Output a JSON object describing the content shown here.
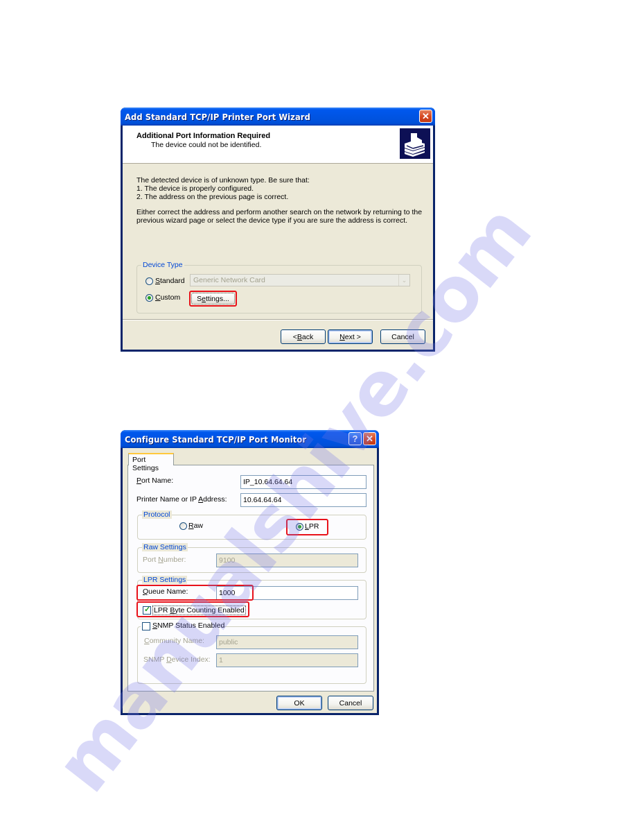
{
  "wizard": {
    "title": "Add Standard TCP/IP Printer Port Wizard",
    "header_title": "Additional Port Information Required",
    "header_subtitle": "The device could not be identified.",
    "header_icon": "printer-wizard-icon",
    "body_lines": [
      "The detected device is of unknown type.  Be sure that:",
      "1. The device is properly configured.",
      "2.  The address on the previous page is correct."
    ],
    "body_paragraph": [
      "Either correct the address and perform another search on the network by returning to the",
      "previous wizard page or select the device type if you are sure the address is correct."
    ],
    "device_type": {
      "group_label": "Device Type",
      "standard_label": "Standard",
      "standard_accel": "S",
      "standard_rest": "tandard",
      "standard_selected": false,
      "standard_dropdown_value": "Generic Network Card",
      "custom_label": "Custom",
      "custom_accel": "C",
      "custom_rest": "ustom",
      "custom_selected": true,
      "settings_button": "Settings...",
      "settings_pre": "S",
      "settings_accel": "e",
      "settings_rest": "ttings..."
    },
    "buttons": {
      "back": "< Back",
      "back_pre": "< ",
      "back_accel": "B",
      "back_rest": "ack",
      "next": "Next >",
      "next_accel": "N",
      "next_rest": "ext >",
      "cancel": "Cancel"
    }
  },
  "monitor": {
    "title": "Configure Standard TCP/IP Port Monitor",
    "tab": "Port Settings",
    "port_name": {
      "label": "Port Name:",
      "accel": "P",
      "rest": "ort Name:",
      "value": "IP_10.64.64.64"
    },
    "printer_address": {
      "label": "Printer Name or IP Address:",
      "pre": "Printer Name or IP ",
      "accel": "A",
      "rest": "ddress:",
      "value": "10.64.64.64"
    },
    "protocol": {
      "group_label": "Protocol",
      "raw_label": "Raw",
      "raw_accel": "R",
      "raw_rest": "aw",
      "raw_selected": false,
      "lpr_label": "LPR",
      "lpr_accel": "L",
      "lpr_rest": "PR",
      "lpr_selected": true
    },
    "raw_settings": {
      "group_label": "Raw Settings",
      "port_number_label": "Port Number:",
      "pre": "Port ",
      "accel": "N",
      "rest": "umber:",
      "port_number_value": "9100"
    },
    "lpr_settings": {
      "group_label": "LPR Settings",
      "queue_name_label": "Queue Name:",
      "accel": "Q",
      "rest": "ueue Name:",
      "queue_name_value": "1000",
      "byte_counting_label": "LPR Byte Counting Enabled",
      "bc_pre": "LPR ",
      "bc_accel": "B",
      "bc_rest": "yte Counting Enabled",
      "byte_counting_checked": true
    },
    "snmp": {
      "label": "SNMP Status Enabled",
      "accel": "S",
      "rest": "NMP Status Enabled",
      "checked": false,
      "community_label": "Community Name:",
      "community_accel": "C",
      "community_rest": "ommunity Name:",
      "community_value": "public",
      "device_index_label": "SNMP Device Index:",
      "di_pre": "SNMP ",
      "di_accel": "D",
      "di_rest": "evice Index:",
      "device_index_value": "1"
    },
    "buttons": {
      "ok": "OK",
      "cancel": "Cancel"
    }
  },
  "watermark": "manualshive.com",
  "colors": {
    "highlight": "#e8121a",
    "titlebar": "#0054e3",
    "dialog_bg": "#ece9d8",
    "group_title": "#0046d5"
  }
}
